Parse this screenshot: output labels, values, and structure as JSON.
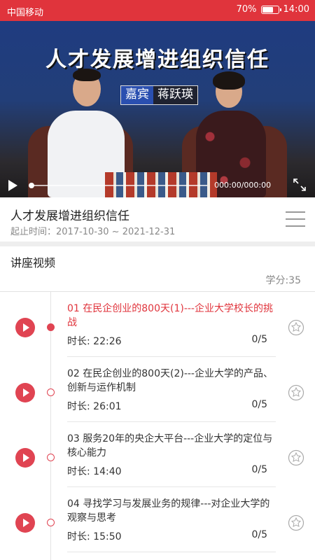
{
  "status_bar": {
    "carrier": "中国移动",
    "battery": "70%",
    "battery_level": 0.7,
    "time": "14:00"
  },
  "video": {
    "banner_title": "人才发展增进组织信任",
    "guest_label": "嘉宾",
    "guest_name": "蒋跃瑛",
    "timecode": "000:00/000:00",
    "progress": 0
  },
  "course": {
    "title": "人才发展增进组织信任",
    "dates": "起止时间：2017-10-30 ~ 2021-12-31"
  },
  "section": {
    "title": "讲座视频",
    "credit": "学分:35"
  },
  "lectures": [
    {
      "title": "01 在民企创业的800天(1)---企业大学校长的挑战",
      "duration": "时长: 22:26",
      "progress": "0/5",
      "active": true
    },
    {
      "title": "02 在民企创业的800天(2)---企业大学的产品、创新与运作机制",
      "duration": "时长: 26:01",
      "progress": "0/5",
      "active": false
    },
    {
      "title": "03 服务20年的央企大平台---企业大学的定位与核心能力",
      "duration": "时长: 14:40",
      "progress": "0/5",
      "active": false
    },
    {
      "title": "04 寻找学习与发展业务的规律---对企业大学的观察与思考",
      "duration": "时长: 15:50",
      "progress": "0/5",
      "active": false
    }
  ],
  "colors": {
    "accent": "#e0343c",
    "play_circle": "#e04452"
  },
  "icons": {
    "play": "play-icon",
    "fullscreen": "fullscreen-icon",
    "menu": "list-menu-icon",
    "stamp": "certificate-stamp-icon"
  }
}
